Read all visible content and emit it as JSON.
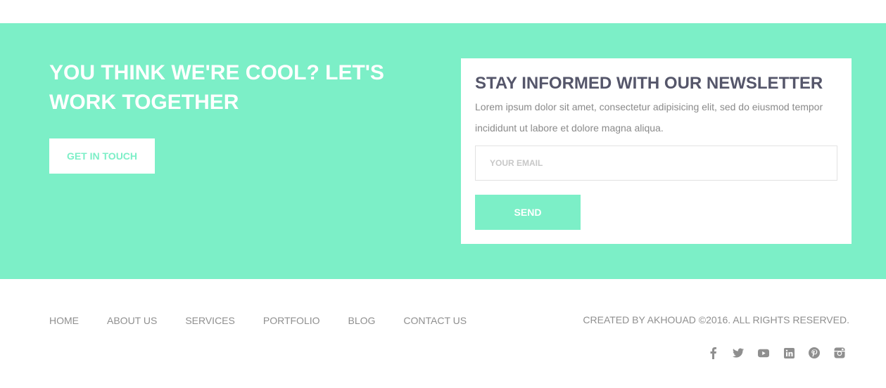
{
  "colors": {
    "accent": "#7cefc7",
    "heading": "#55566a",
    "text": "#8a8a8a",
    "footer_text": "#8f8f8f"
  },
  "cta": {
    "title": "YOU THINK WE'RE COOL? LET'S WORK TOGETHER",
    "button_label": "GET IN TOUCH"
  },
  "newsletter": {
    "title": "STAY INFORMED WITH OUR NEWSLETTER",
    "text": "Lorem ipsum dolor sit amet, consectetur adipisicing elit, sed do eiusmod tempor incididunt ut labore et dolore magna aliqua.",
    "email_placeholder": "YOUR EMAIL",
    "send_label": "SEND"
  },
  "footer": {
    "nav": [
      {
        "label": "HOME"
      },
      {
        "label": "ABOUT US"
      },
      {
        "label": "SERVICES"
      },
      {
        "label": "PORTFOLIO"
      },
      {
        "label": "BLOG"
      },
      {
        "label": "CONTACT US"
      }
    ],
    "copyright": "CREATED BY AKHOUAD ©2016. ALL RIGHTS RESERVED.",
    "socials": [
      "facebook-icon",
      "twitter-icon",
      "youtube-icon",
      "linkedin-icon",
      "pinterest-icon",
      "instagram-icon"
    ]
  }
}
